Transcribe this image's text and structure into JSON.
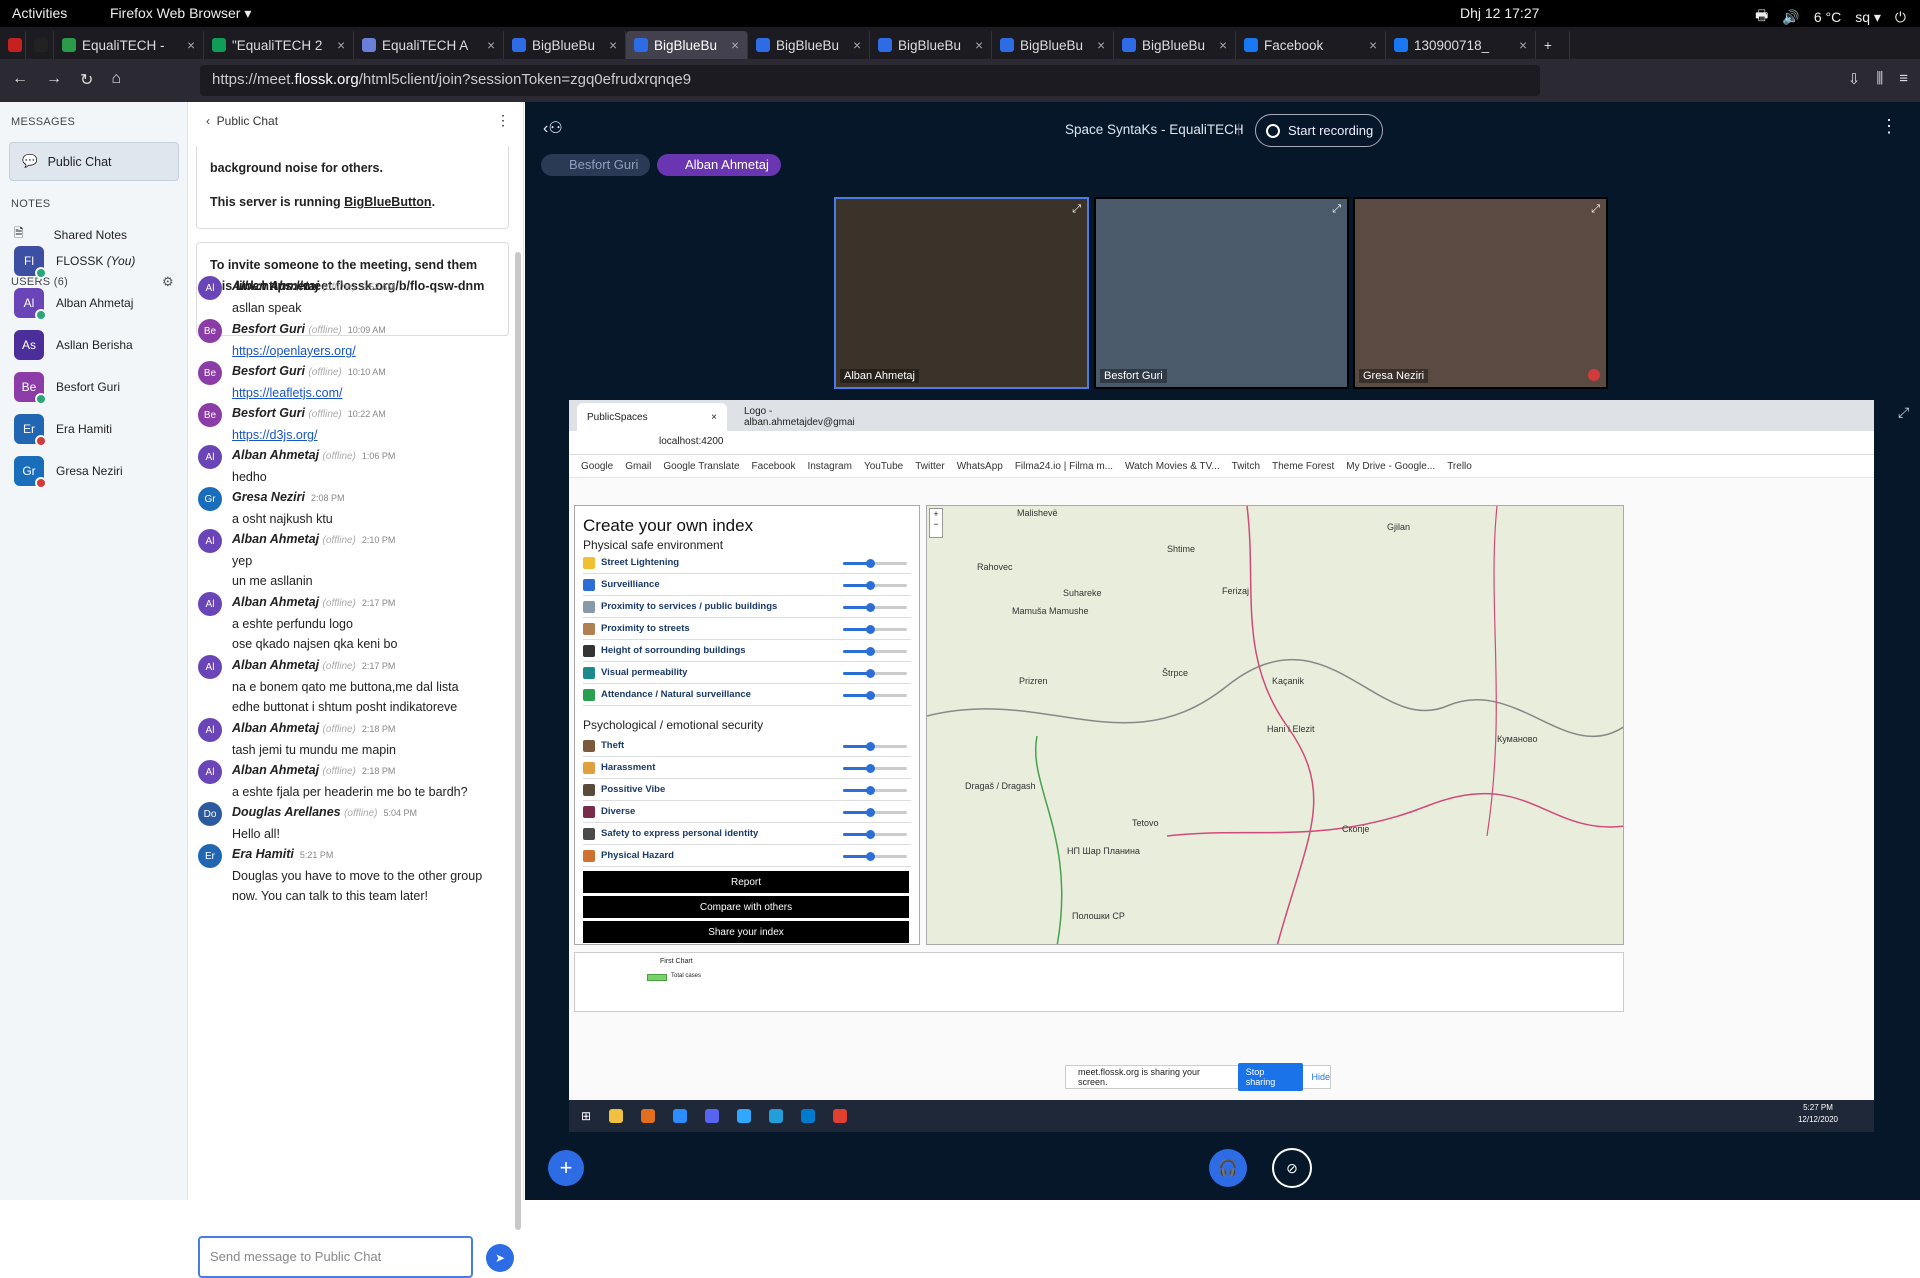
{
  "gnome": {
    "activities": "Activities",
    "app": "Firefox Web Browser ▾",
    "weather": "6 °C",
    "lang": "sq ▾",
    "clock": "Dhj 12  17:27"
  },
  "tabs": [
    {
      "label": "",
      "color": "#c5221f"
    },
    {
      "label": "",
      "color": "#222"
    },
    {
      "label": "EqualiTECH -",
      "color": "#2b9a4a"
    },
    {
      "label": "\"EqualiTECH 2",
      "color": "#0f9d58"
    },
    {
      "label": "EqualiTECH A",
      "color": "#6a7fd8"
    },
    {
      "label": "BigBlueBu",
      "color": "#2e6ce6"
    },
    {
      "label": "BigBlueBu",
      "color": "#2e6ce6",
      "active": true
    },
    {
      "label": "BigBlueBu",
      "color": "#2e6ce6"
    },
    {
      "label": "BigBlueBu",
      "color": "#2e6ce6"
    },
    {
      "label": "BigBlueBu",
      "color": "#2e6ce6"
    },
    {
      "label": "BigBlueBu",
      "color": "#2e6ce6"
    },
    {
      "label": "Facebook",
      "color": "#1877f2"
    },
    {
      "label": "130900718_",
      "color": "#1877f2"
    }
  ],
  "nav": {
    "url_prefix": "https://meet.",
    "url_domain": "flossk.org",
    "url_rest": "/html5client/join?sessionToken=zgq0efrudxrqnqe9"
  },
  "sidebar": {
    "messages_header": "MESSAGES",
    "public_chat": "Public Chat",
    "notes_header": "NOTES",
    "shared_notes": "Shared Notes",
    "users_header": "USERS (6)",
    "users": [
      {
        "initials": "Fl",
        "name": "FLOSSK",
        "you": "(You)",
        "color": "#3c4fa3",
        "status": "#2aa57c"
      },
      {
        "initials": "Al",
        "name": "Alban Ahmetaj",
        "you": "",
        "color": "#6a45b8",
        "status": "#2aa57c"
      },
      {
        "initials": "As",
        "name": "Asllan Berisha",
        "you": "",
        "color": "#4b2e9a",
        "status": ""
      },
      {
        "initials": "Be",
        "name": "Besfort Guri",
        "you": "",
        "color": "#8b3ca7",
        "status": "#2aa57c"
      },
      {
        "initials": "Er",
        "name": "Era Hamiti",
        "you": "",
        "color": "#2166b3",
        "status": "#d23b3b"
      },
      {
        "initials": "Gr",
        "name": "Gresa Neziri",
        "you": "",
        "color": "#1a6dbb",
        "status": "#d23b3b"
      }
    ]
  },
  "chat": {
    "title": "Public Chat",
    "notice1_a": "background noise for others.",
    "notice1_b": "This server is running ",
    "notice1_link": "BigBlueButton",
    "notice2": "To invite someone to the meeting, send them this link:https://meet.flossk.org/b/flo-qsw-dnm",
    "offline": "(offline)",
    "messages": [
      {
        "initials": "Al",
        "color": "#6a45b8",
        "name": "Alban Ahmetaj",
        "off": true,
        "time": "9:52 AM",
        "lines": [
          "asllan speak"
        ]
      },
      {
        "initials": "Be",
        "color": "#8b3ca7",
        "name": "Besfort Guri",
        "off": true,
        "time": "10:09 AM",
        "link": "https://openlayers.org/"
      },
      {
        "initials": "Be",
        "color": "#8b3ca7",
        "name": "Besfort Guri",
        "off": true,
        "time": "10:10 AM",
        "link": "https://leafletjs.com/"
      },
      {
        "initials": "Be",
        "color": "#8b3ca7",
        "name": "Besfort Guri",
        "off": true,
        "time": "10:22 AM",
        "link": "https://d3js.org/"
      },
      {
        "initials": "Al",
        "color": "#6a45b8",
        "name": "Alban Ahmetaj",
        "off": true,
        "time": "1:06 PM",
        "lines": [
          "hedho"
        ]
      },
      {
        "initials": "Gr",
        "color": "#1a6dbb",
        "name": "Gresa Neziri",
        "off": false,
        "time": "2:08 PM",
        "lines": [
          "a osht najkush ktu"
        ]
      },
      {
        "initials": "Al",
        "color": "#6a45b8",
        "name": "Alban Ahmetaj",
        "off": true,
        "time": "2:10 PM",
        "lines": [
          "yep",
          "un me asllanin"
        ]
      },
      {
        "initials": "Al",
        "color": "#6a45b8",
        "name": "Alban Ahmetaj",
        "off": true,
        "time": "2:17 PM",
        "lines": [
          "a eshte perfundu logo",
          "ose qkado najsen qka keni bo"
        ]
      },
      {
        "initials": "Al",
        "color": "#6a45b8",
        "name": "Alban Ahmetaj",
        "off": true,
        "time": "2:17 PM",
        "lines": [
          "na e bonem qato me buttona,me dal lista",
          "edhe buttonat i shtum posht indikatoreve"
        ]
      },
      {
        "initials": "Al",
        "color": "#6a45b8",
        "name": "Alban Ahmetaj",
        "off": true,
        "time": "2:18 PM",
        "lines": [
          "tash jemi tu mundu me mapin"
        ]
      },
      {
        "initials": "Al",
        "color": "#6a45b8",
        "name": "Alban Ahmetaj",
        "off": true,
        "time": "2:18 PM",
        "lines": [
          "a eshte fjala per headerin me bo te bardh?"
        ]
      },
      {
        "initials": "Do",
        "color": "#2c5aa0",
        "name": "Douglas Arellanes",
        "off": true,
        "time": "5:04 PM",
        "lines": [
          "Hello all!"
        ]
      },
      {
        "initials": "Er",
        "color": "#2166b3",
        "name": "Era Hamiti",
        "off": false,
        "time": "5:21 PM",
        "lines": [
          "Douglas you have to move to the other group",
          "now. You can talk to this team later!"
        ]
      }
    ],
    "placeholder": "Send message to Public Chat"
  },
  "meeting": {
    "title": "Space SyntaKs - EqualiTECH",
    "record": "Start recording",
    "talkers": [
      {
        "name": "Besfort Guri",
        "color": "#2a3a55"
      },
      {
        "name": "Alban Ahmetaj",
        "color": "#6a35b0"
      }
    ],
    "videos": [
      "Alban Ahmetaj",
      "Besfort Guri",
      "Gresa Neziri"
    ]
  },
  "shared": {
    "tab1": "PublicSpaces",
    "tab2": "Logo - alban.ahmetajdev@gmai",
    "url": "localhost:4200",
    "bookmarks": [
      "Google",
      "Gmail",
      "Google Translate",
      "Facebook",
      "Instagram",
      "YouTube",
      "Twitter",
      "WhatsApp",
      "Filma24.io | Filma m...",
      "Watch Movies & TV...",
      "Twitch",
      "Theme Forest",
      "My Drive - Google...",
      "Trello"
    ],
    "panel_title": "Create your own index",
    "sec1": "Physical safe environment",
    "items1": [
      {
        "label": "Street Lightening",
        "color": "#f0c030",
        "value": 0.42
      },
      {
        "label": "Surveilliance",
        "color": "#2b6fd6",
        "value": 0.42
      },
      {
        "label": "Proximity to services / public buildings",
        "color": "#8899aa",
        "value": 0.42
      },
      {
        "label": "Proximity to streets",
        "color": "#b08050",
        "value": 0.42
      },
      {
        "label": "Height of sorrounding buildings",
        "color": "#333333",
        "value": 0.42
      },
      {
        "label": "Visual permeability",
        "color": "#1a8a8a",
        "value": 0.42
      },
      {
        "label": "Attendance / Natural surveillance",
        "color": "#2aa050",
        "value": 0.42
      }
    ],
    "sec2": "Psychological / emotional security",
    "items2": [
      {
        "label": "Theft",
        "color": "#7a5a3a",
        "value": 0.42
      },
      {
        "label": "Harassment",
        "color": "#e0a040",
        "value": 0.42
      },
      {
        "label": "Possitive Vibe",
        "color": "#5a4a3a",
        "value": 0.42
      },
      {
        "label": "Diverse",
        "color": "#7a2a4a",
        "value": 0.42
      },
      {
        "label": "Safety to express personal identity",
        "color": "#4a4a4a",
        "value": 0.42
      },
      {
        "label": "Physical Hazard",
        "color": "#d07030",
        "value": 0.42
      }
    ],
    "buttons": [
      "Report",
      "Compare with others",
      "Share your index"
    ],
    "places": [
      "Malishevë",
      "Gjilan",
      "Ferizaj",
      "Shtime",
      "Rahovec",
      "Suhareke",
      "Mamuša Mamushe",
      "Prizren",
      "Štrpce",
      "Kaçanik",
      "Hani i Elezit",
      "Dragaš / Dragash",
      "Tetovo",
      "НП Шар Планина",
      "Скопје",
      "Куманово",
      "Полошки СР"
    ],
    "chart_label": "First Chart",
    "chart_legend": "Total cases",
    "share_text": "meet.flossk.org is sharing your screen.",
    "stop": "Stop sharing",
    "hide": "Hide",
    "win_time": "5:27 PM",
    "win_date": "12/12/2020"
  }
}
